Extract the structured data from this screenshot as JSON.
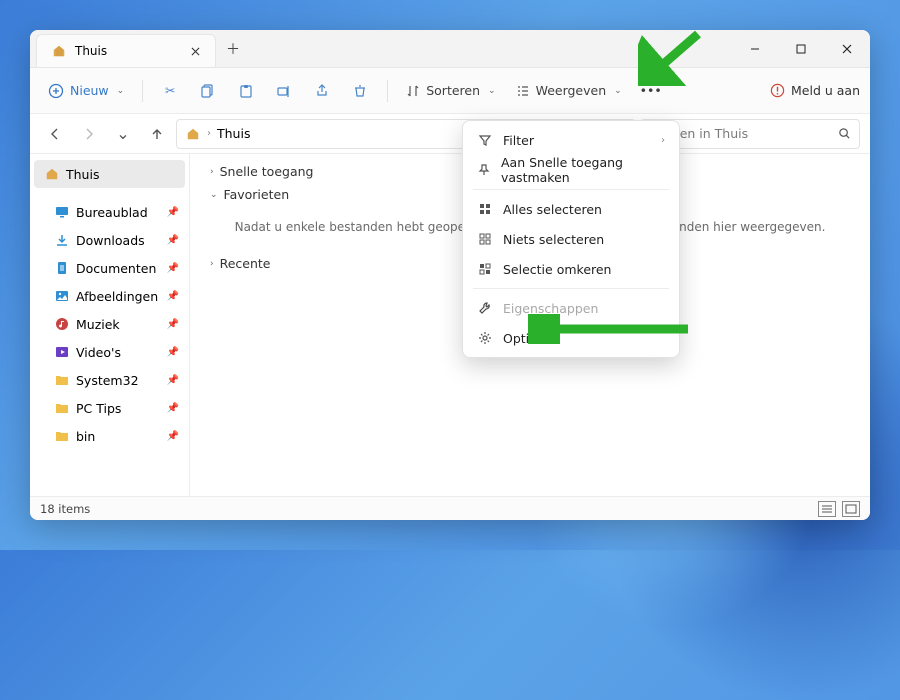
{
  "window": {
    "tab_title": "Thuis"
  },
  "toolbar": {
    "new_label": "Nieuw",
    "sort_label": "Sorteren",
    "view_label": "Weergeven",
    "signin_label": "Meld u aan"
  },
  "nav": {
    "breadcrumb_root": "Thuis",
    "search_placeholder": "Zoeken in Thuis"
  },
  "sidebar": {
    "home": "Thuis",
    "items": [
      {
        "label": "Bureaublad",
        "icon": "desktop",
        "color": "#2f8fd4"
      },
      {
        "label": "Downloads",
        "icon": "download",
        "color": "#2f8fd4"
      },
      {
        "label": "Documenten",
        "icon": "document",
        "color": "#2f8fd4"
      },
      {
        "label": "Afbeeldingen",
        "icon": "pictures",
        "color": "#2f8fd4"
      },
      {
        "label": "Muziek",
        "icon": "music",
        "color": "#c94343"
      },
      {
        "label": "Video's",
        "icon": "video",
        "color": "#6b3fc4"
      },
      {
        "label": "System32",
        "icon": "folder",
        "color": "#f0c04a"
      },
      {
        "label": "PC Tips",
        "icon": "folder",
        "color": "#f0c04a"
      },
      {
        "label": "bin",
        "icon": "folder",
        "color": "#f0c04a"
      }
    ]
  },
  "content": {
    "groups": [
      {
        "label": "Snelle toegang",
        "expanded": false
      },
      {
        "label": "Favorieten",
        "expanded": true
      },
      {
        "label": "Recente",
        "expanded": false
      }
    ],
    "empty_message": "Nadat u enkele bestanden hebt geopend, worden de meest recente bestanden hier weergegeven."
  },
  "menu": {
    "items": [
      {
        "key": "filter",
        "label": "Filter",
        "icon": "funnel",
        "submenu": true
      },
      {
        "key": "pin",
        "label": "Aan Snelle toegang vastmaken",
        "icon": "pin"
      },
      {
        "sep": true
      },
      {
        "key": "selectall",
        "label": "Alles selecteren",
        "icon": "select-all"
      },
      {
        "key": "selectnone",
        "label": "Niets selecteren",
        "icon": "select-none"
      },
      {
        "key": "invert",
        "label": "Selectie omkeren",
        "icon": "select-invert"
      },
      {
        "sep": true
      },
      {
        "key": "properties",
        "label": "Eigenschappen",
        "icon": "wrench",
        "disabled": true
      },
      {
        "key": "options",
        "label": "Opties",
        "icon": "gear"
      }
    ]
  },
  "status": {
    "count_label": "18 items"
  }
}
